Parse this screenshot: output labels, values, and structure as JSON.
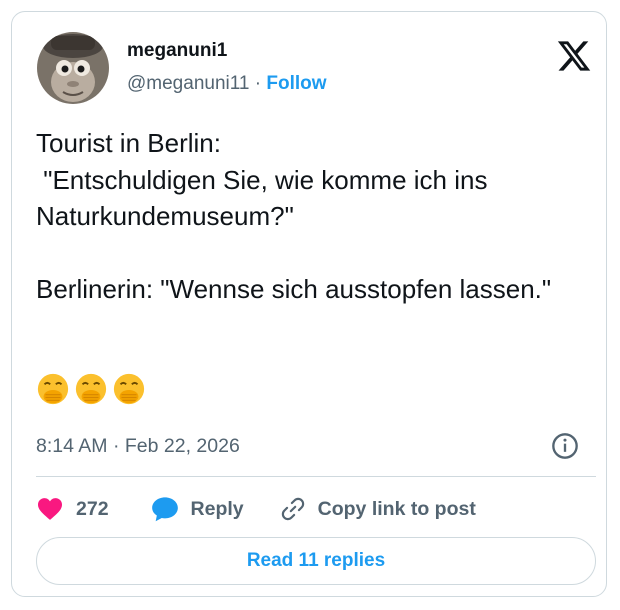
{
  "author": {
    "display_name": "meganuni1",
    "handle": "@meganuni11",
    "separator": "·",
    "follow_label": "Follow"
  },
  "tweet": {
    "text": "Tourist in Berlin:\n \"Entschuldigen Sie, wie komme ich ins Naturkundemuseum?\"\n\nBerlinerin: \"Wennse sich ausstopfen lassen.\"",
    "emojis": [
      "face-with-hand-over-mouth",
      "face-with-hand-over-mouth",
      "face-with-hand-over-mouth"
    ],
    "timestamp": "8:14 AM · Feb 22, 2026"
  },
  "actions": {
    "like_count": "272",
    "reply_label": "Reply",
    "copy_label": "Copy link to post"
  },
  "footer": {
    "read_replies_label": "Read 11 replies"
  },
  "colors": {
    "accent": "#1d9bf0",
    "like": "#f91880",
    "muted": "#536471",
    "border": "#cfd9de"
  }
}
